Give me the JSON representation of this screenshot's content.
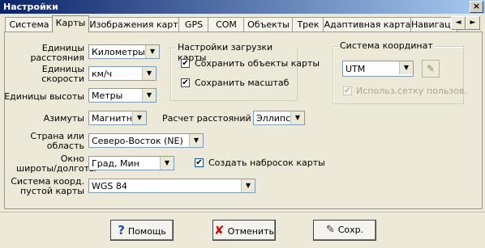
{
  "window": {
    "title": "Настройки",
    "close_label": "×"
  },
  "tabs": [
    {
      "label": "Система"
    },
    {
      "label": "Карты"
    },
    {
      "label": "Изображения карт"
    },
    {
      "label": "GPS"
    },
    {
      "label": "COM"
    },
    {
      "label": "Объекты"
    },
    {
      "label": "Трек"
    },
    {
      "label": "Адаптивная карта"
    },
    {
      "label": "Навигация"
    }
  ],
  "tab_arrows": {
    "left": "◄",
    "right": "►"
  },
  "form": {
    "distance_units": {
      "label_line1": "Единицы",
      "label_line2": "расстояния",
      "value": "Километры"
    },
    "speed_units": {
      "label_line1": "Единицы",
      "label_line2": "скорости",
      "value": "км/ч"
    },
    "height_units": {
      "label": "Единицы высоты",
      "value": "Метры"
    },
    "azimuths": {
      "label": "Азимуты",
      "value": "Магнитный"
    },
    "distance_calc": {
      "label": "Расчет расстояний",
      "value": "Эллипсо"
    },
    "country": {
      "label_line1": "Страна или",
      "label_line2": "область",
      "value": "Северо-Восток (NE)"
    },
    "latlon_window": {
      "label_line1": "Окно",
      "label_line2": "широты/долготы",
      "value": "Град, Мин"
    },
    "empty_map_coord": {
      "label_line1": "Система коорд.",
      "label_line2": "пустой карты",
      "value": "WGS 84"
    },
    "create_sketch": {
      "label": "Создать набросок карты",
      "checked": true
    }
  },
  "map_load_group": {
    "title": "Настройки загрузки карты",
    "save_objects": {
      "label": "Сохранить объекты карты",
      "checked": true
    },
    "save_scale": {
      "label": "Сохранить масштаб",
      "checked": true
    }
  },
  "coord_group": {
    "title": "Система координат",
    "value": "UTM",
    "user_grid": {
      "label": "Использ.сетку пользов.",
      "checked": true,
      "disabled": true
    }
  },
  "buttons": {
    "help": "Помощь",
    "cancel": "Отменить",
    "save": "Сохр."
  },
  "icons": {
    "check": "✔",
    "dropdown": "▼",
    "help": "?",
    "cancel": "✘",
    "save": "✎",
    "map_pick": "✎"
  }
}
